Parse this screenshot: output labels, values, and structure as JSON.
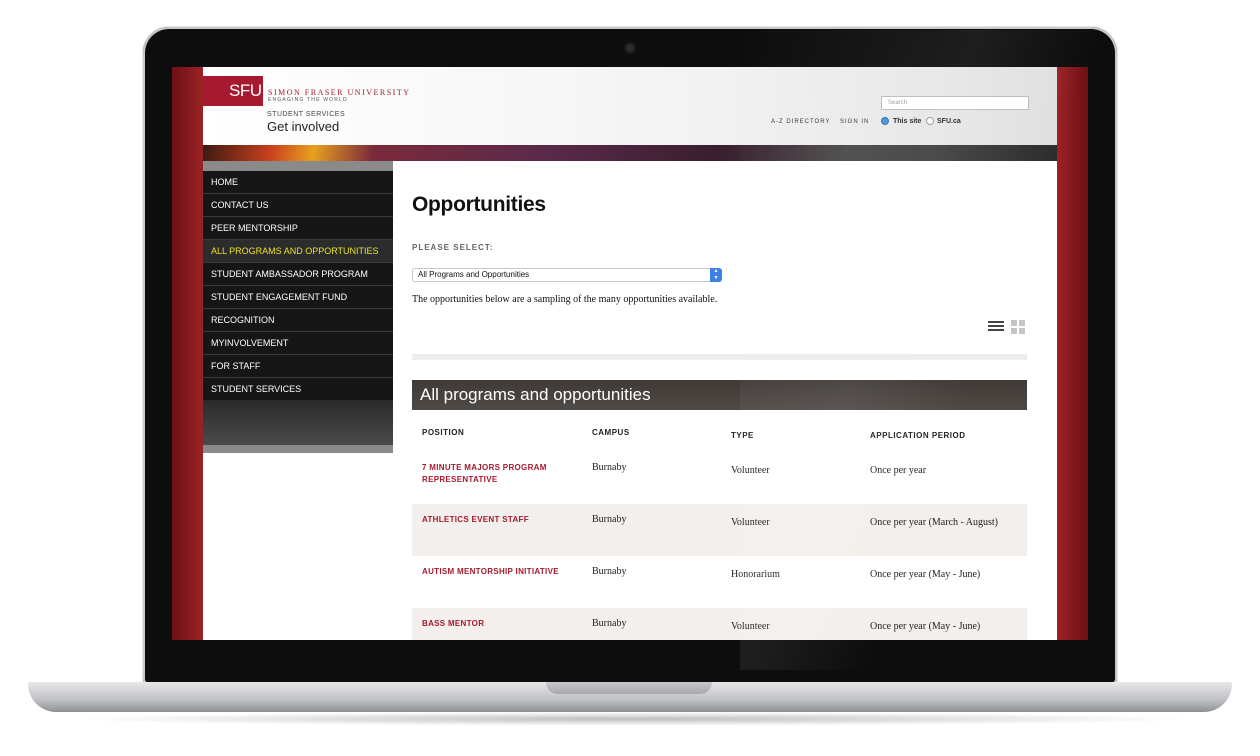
{
  "header": {
    "logo_text": "SFU",
    "university_name": "SIMON FRASER UNIVERSITY",
    "tagline": "ENGAGING THE WORLD",
    "department": "STUDENT SERVICES",
    "site_title": "Get involved",
    "search_placeholder": "Search",
    "links": [
      "A-Z DIRECTORY",
      "SIGN IN"
    ],
    "search_scope": {
      "option_1": "This site",
      "option_2": "SFU.ca",
      "selected": "This site"
    }
  },
  "sidebar": {
    "items": [
      {
        "label": "HOME"
      },
      {
        "label": "CONTACT US"
      },
      {
        "label": "PEER MENTORSHIP"
      },
      {
        "label": "ALL PROGRAMS AND OPPORTUNITIES",
        "active": true
      },
      {
        "label": "STUDENT AMBASSADOR PROGRAM"
      },
      {
        "label": "STUDENT ENGAGEMENT FUND"
      },
      {
        "label": "RECOGNITION"
      },
      {
        "label": "MYINVOLVEMENT"
      },
      {
        "label": "FOR STAFF"
      },
      {
        "label": "STUDENT SERVICES"
      }
    ]
  },
  "main": {
    "title": "Opportunities",
    "select_label": "PLEASE SELECT:",
    "select_value": "All Programs and Opportunities",
    "intro": "The opportunities below are a sampling of the many opportunities available.",
    "section_title": "All programs and opportunities",
    "table": {
      "headers": {
        "position": "POSITION",
        "campus": "CAMPUS",
        "type": "TYPE",
        "period": "APPLICATION PERIOD"
      },
      "rows": [
        {
          "position": "7 MINUTE MAJORS PROGRAM REPRESENTATIVE",
          "campus": "Burnaby",
          "type": "Volunteer",
          "period": "Once per year"
        },
        {
          "position": "ATHLETICS EVENT STAFF",
          "campus": "Burnaby",
          "type": "Volunteer",
          "period": "Once per year (March - August)"
        },
        {
          "position": "AUTISM MENTORSHIP INITIATIVE",
          "campus": "Burnaby",
          "type": "Honorarium",
          "period": "Once per year (May - June)"
        },
        {
          "position": "BASS MENTOR",
          "campus": "Burnaby",
          "type": "Volunteer",
          "period": "Once per year (May - June)"
        }
      ]
    }
  },
  "colors": {
    "sfu_red": "#a6192e",
    "active_nav": "#e8e02e",
    "nav_bg": "#161616"
  },
  "icons": {
    "view_list": "list-view-icon",
    "view_grid": "grid-view-icon",
    "select_arrow": "select-arrows-icon"
  }
}
